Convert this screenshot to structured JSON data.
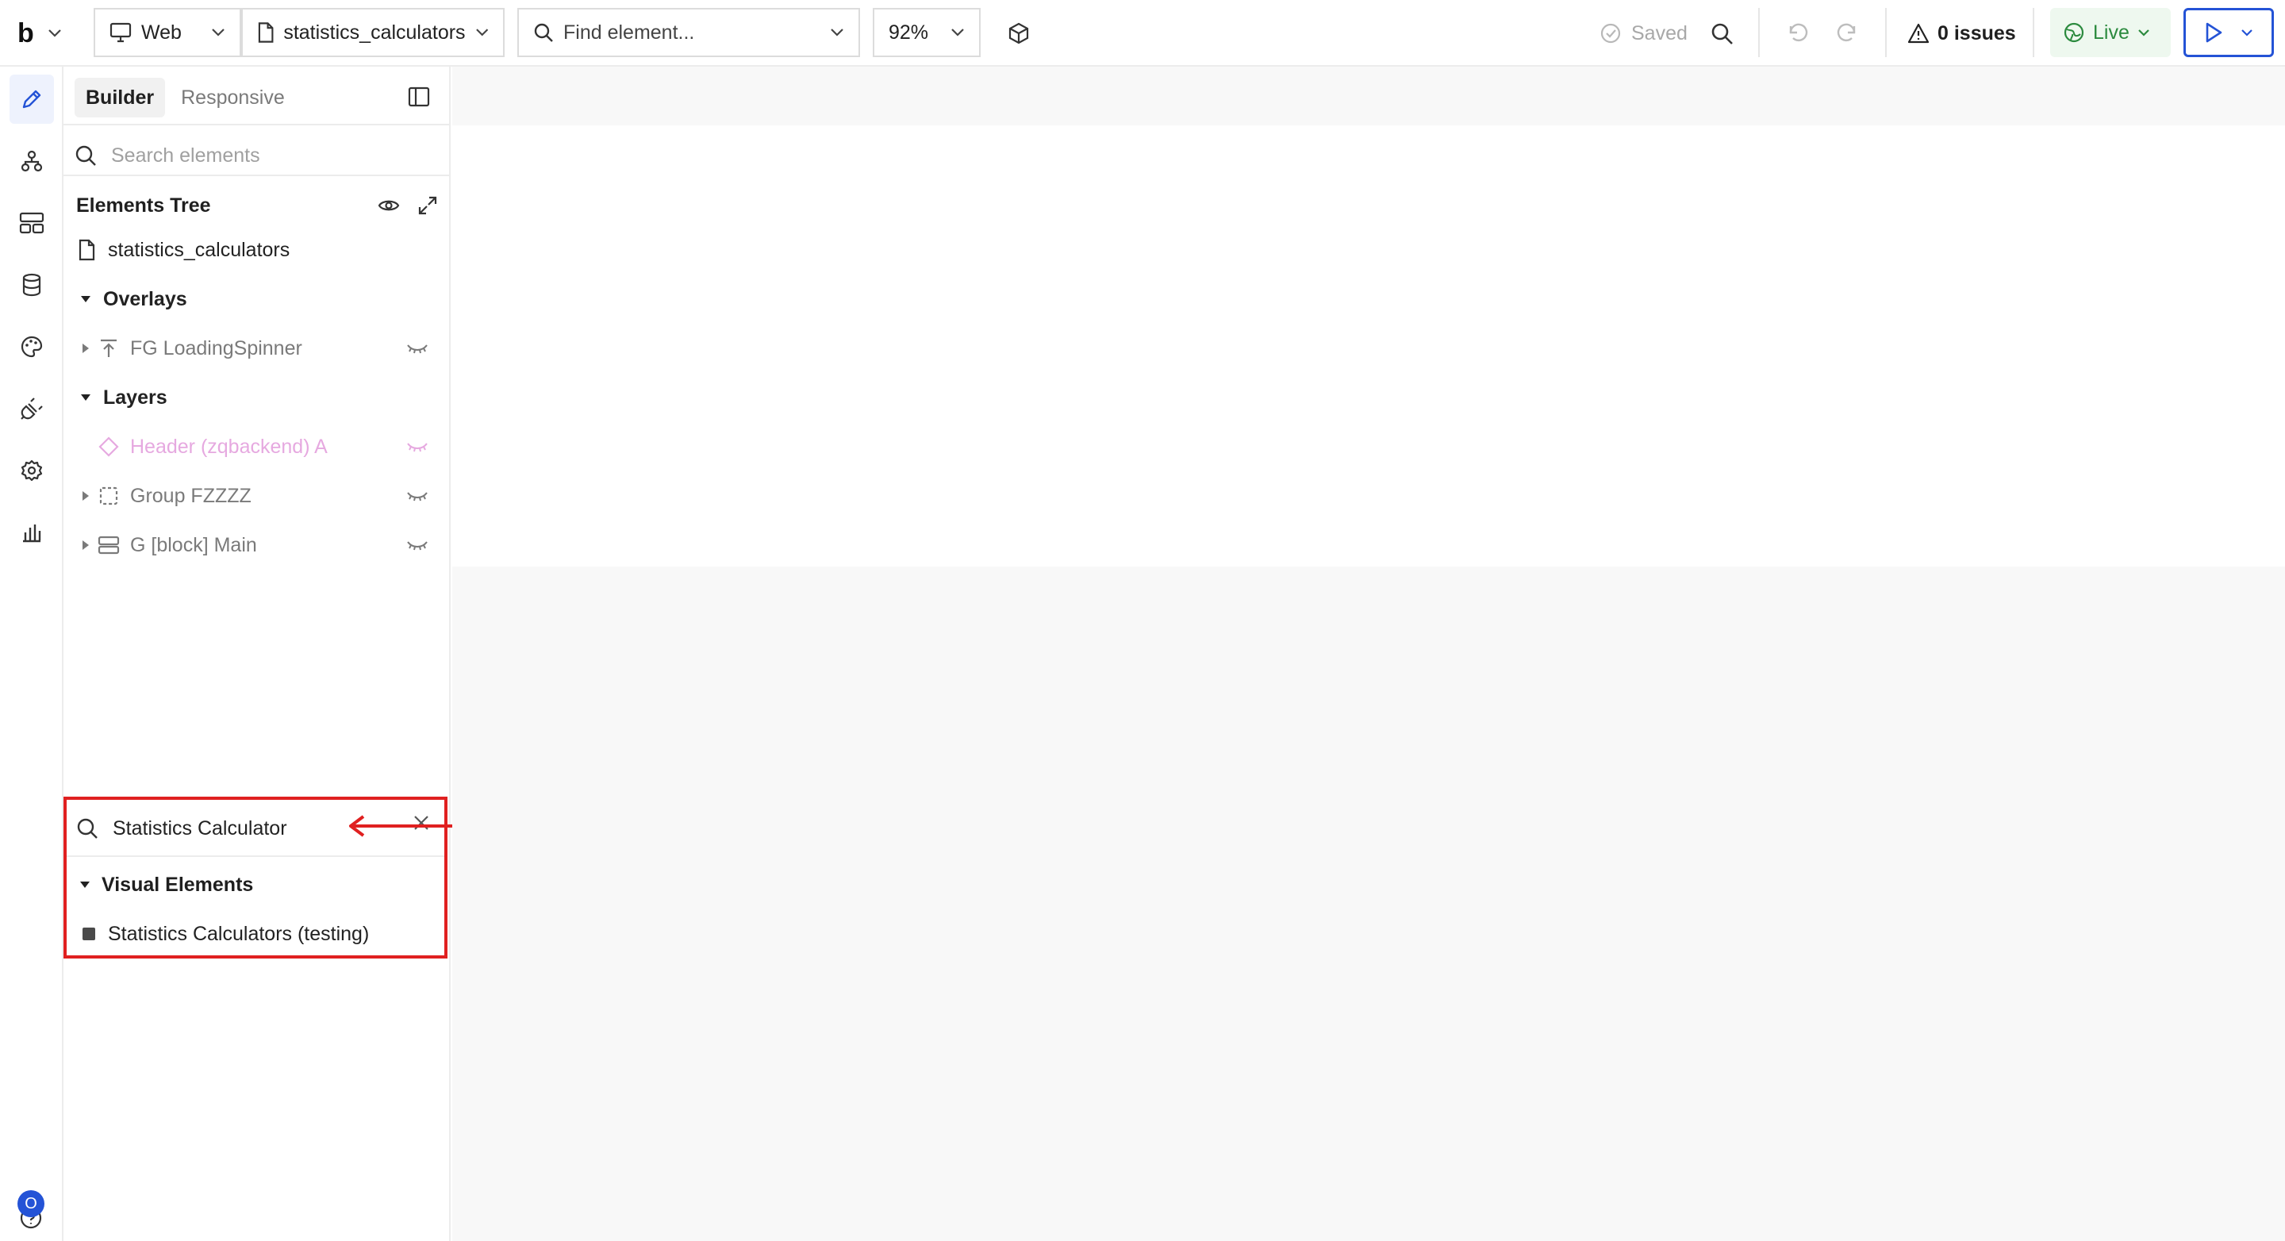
{
  "topbar": {
    "logo_text": "b",
    "device": {
      "label": "Web"
    },
    "page": {
      "label": "statistics_calculators"
    },
    "find": {
      "placeholder": "Find element..."
    },
    "zoom": {
      "label": "92%"
    },
    "saved_label": "Saved",
    "issues_label": "0 issues",
    "live_label": "Live"
  },
  "panel": {
    "tabs": [
      {
        "label": "Builder",
        "active": true
      },
      {
        "label": "Responsive",
        "active": false
      }
    ],
    "search_placeholder": "Search elements",
    "tree_title": "Elements Tree",
    "page_name": "statistics_calculators",
    "overlays_label": "Overlays",
    "overlay_items": [
      {
        "label": "FG LoadingSpinner"
      }
    ],
    "layers_label": "Layers",
    "layer_items": [
      {
        "label": "Header (zqbackend) A"
      },
      {
        "label": "Group FZZZZ"
      },
      {
        "label": "G [block] Main"
      }
    ]
  },
  "results": {
    "query": "Statistics Calculator",
    "section_label": "Visual Elements",
    "items": [
      {
        "label": "Statistics Calculators (testing)"
      }
    ]
  },
  "user": {
    "avatar_initial": "O"
  },
  "colors": {
    "accent": "#2453d6",
    "live_green": "#2b8a3e",
    "annotation_red": "#e02020",
    "canvas_bg": "#f8f8f8"
  }
}
